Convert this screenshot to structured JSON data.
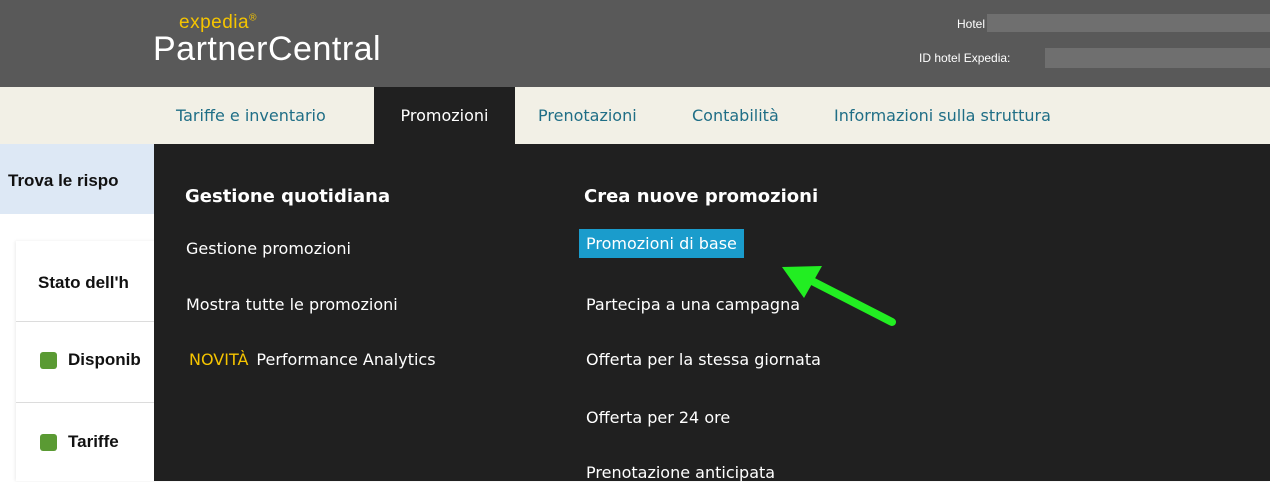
{
  "header": {
    "logo_top": "expedia",
    "logo_reg": "®",
    "logo_main": "PartnerCentral",
    "hotel_label": "Hotel",
    "hotel_id_label": "ID hotel Expedia: ",
    "bg_color": "#595959",
    "logo_accent": "#f5c400"
  },
  "nav": {
    "items": [
      {
        "label": "Tariffe e inventario"
      },
      {
        "label": "Promozioni"
      },
      {
        "label": "Prenotazioni"
      },
      {
        "label": "Contabilità"
      },
      {
        "label": "Informazioni sulla struttura"
      }
    ],
    "active_index": 1,
    "link_color": "#1f6e86"
  },
  "page": {
    "find_text": "Trova le rispo",
    "status_text": "Stato dell'h",
    "rows": [
      {
        "label": "Disponib",
        "icon": "green-square-icon"
      },
      {
        "label": "Tariffe",
        "icon": "green-square-icon"
      }
    ]
  },
  "dropdown": {
    "col1": {
      "heading": "Gestione quotidiana",
      "items": [
        {
          "label": "Gestione promozioni"
        },
        {
          "label": "Mostra tutte le promozioni"
        },
        {
          "badge": "NOVITÀ",
          "label": "Performance Analytics"
        }
      ]
    },
    "col2": {
      "heading": "Crea nuove promozioni",
      "items": [
        {
          "label": "Promozioni di base",
          "highlighted": true
        },
        {
          "label": "Partecipa a una campagna"
        },
        {
          "label": "Offerta per la stessa giornata"
        },
        {
          "label": "Offerta per 24 ore"
        },
        {
          "label": "Prenotazione anticipata"
        }
      ]
    },
    "bg_color": "#202020",
    "highlight_color": "#1a9ccc"
  },
  "annotation": {
    "arrow_icon": "green-arrow-icon",
    "arrow_color": "#22ee22"
  }
}
